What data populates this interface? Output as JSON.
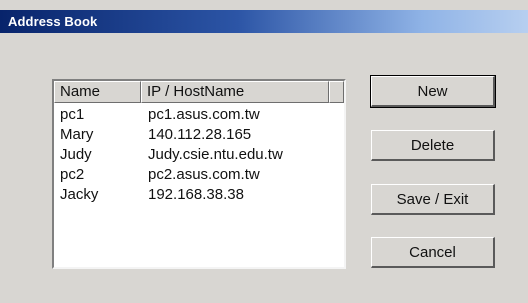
{
  "window": {
    "title": "Address Book"
  },
  "list": {
    "columns": [
      "Name",
      "IP / HostName"
    ],
    "rows": [
      {
        "name": "pc1",
        "host": "pc1.asus.com.tw"
      },
      {
        "name": "Mary",
        "host": "140.112.28.165"
      },
      {
        "name": "Judy",
        "host": "Judy.csie.ntu.edu.tw"
      },
      {
        "name": "pc2",
        "host": "pc2.asus.com.tw"
      },
      {
        "name": "Jacky",
        "host": "192.168.38.38"
      }
    ]
  },
  "buttons": {
    "new": "New",
    "delete": "Delete",
    "save_exit": "Save / Exit",
    "cancel": "Cancel"
  },
  "colors": {
    "titlebar_start": "#08246b",
    "titlebar_end": "#b7cff0",
    "dialog_bg": "#d8d6d2"
  }
}
